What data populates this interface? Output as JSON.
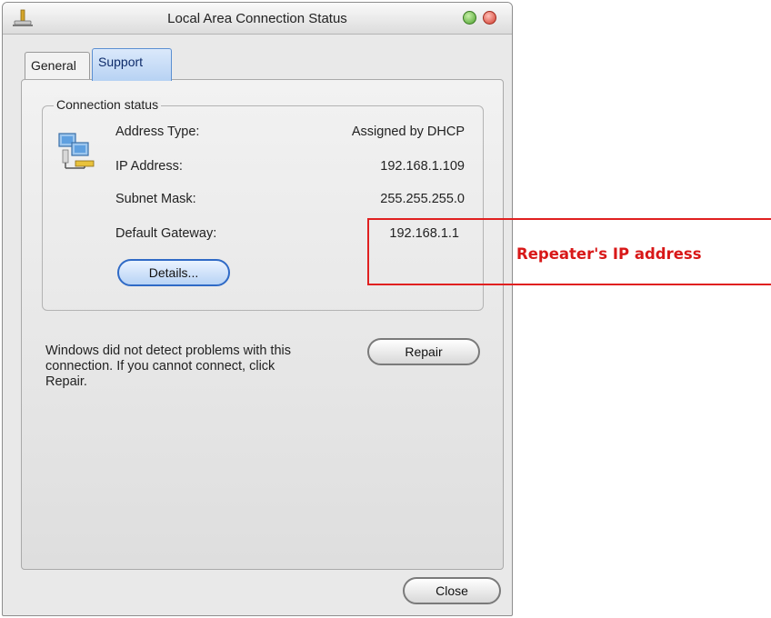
{
  "window": {
    "title": "Local Area Connection Status",
    "icons": {
      "app": "network-connection-icon",
      "minimize": "minimize-icon",
      "close": "close-icon"
    }
  },
  "tabs": [
    {
      "label": "General",
      "selected": false
    },
    {
      "label": "Support",
      "selected": true
    }
  ],
  "connection_status": {
    "group_title": "Connection status",
    "icon": "network-computers-icon",
    "rows": [
      {
        "label": "Address Type:",
        "value": "Assigned by DHCP"
      },
      {
        "label": "IP Address:",
        "value": "192.168.1.109"
      },
      {
        "label": "Subnet Mask:",
        "value": "255.255.255.0"
      },
      {
        "label": "Default Gateway:",
        "value": "192.168.1.1"
      }
    ],
    "details_label": "Details..."
  },
  "repair_section": {
    "message": "Windows did not detect problems with this connection. If you cannot connect, click Repair.",
    "repair_label": "Repair"
  },
  "footer": {
    "close_label": "Close"
  },
  "annotation": {
    "label": "Repeater's IP address",
    "color": "#d81818"
  }
}
